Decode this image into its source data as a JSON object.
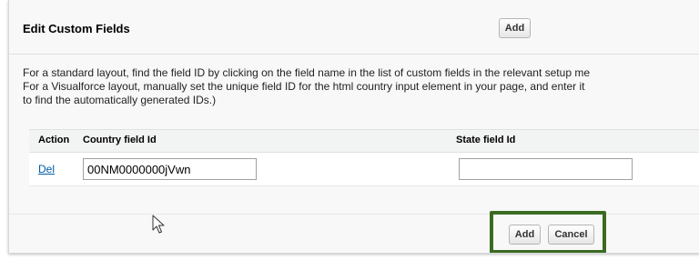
{
  "section": {
    "title": "Edit Custom Fields",
    "add_top_label": "Add"
  },
  "description": {
    "line1": "For a standard layout, find the field ID by clicking on the field name in the list of custom fields in the relevant setup me",
    "line2": "For a Visualforce layout, manually set the unique field ID for the html country input element in your page, and enter it",
    "line3": "to find the automatically generated IDs.)"
  },
  "table": {
    "headers": {
      "action": "Action",
      "country": "Country field Id",
      "state": "State field Id"
    },
    "rows": [
      {
        "action_label": "Del",
        "country_value": "00NM0000000jVwn",
        "state_value": ""
      }
    ]
  },
  "footer": {
    "add_label": "Add",
    "cancel_label": "Cancel"
  },
  "icons": {
    "cursor": "mouse-pointer-icon"
  },
  "colors": {
    "highlight_border": "#3a6b22",
    "link": "#015ba7"
  }
}
